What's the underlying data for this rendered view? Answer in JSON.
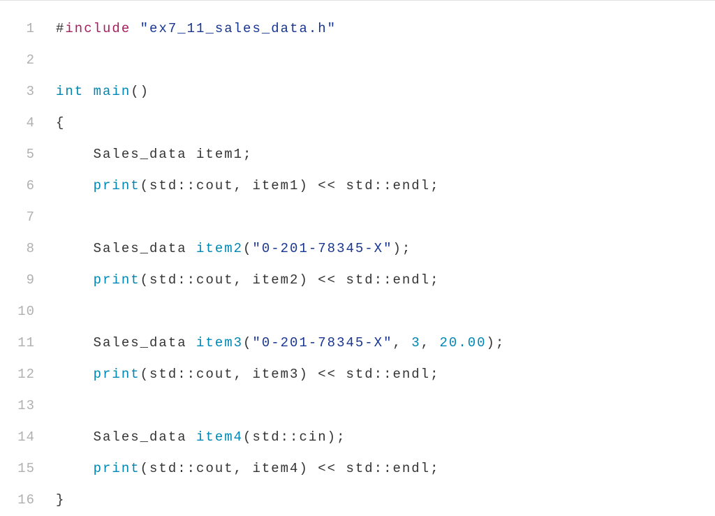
{
  "lines": [
    {
      "number": "1",
      "indent": "",
      "tokens": [
        {
          "text": "#",
          "class": "tk-text"
        },
        {
          "text": "include",
          "class": "tk-preprocessor"
        },
        {
          "text": " ",
          "class": "tk-text"
        },
        {
          "text": "\"ex7_11_sales_data.h\"",
          "class": "tk-string"
        }
      ]
    },
    {
      "number": "2",
      "indent": "",
      "tokens": []
    },
    {
      "number": "3",
      "indent": "",
      "tokens": [
        {
          "text": "int",
          "class": "tk-type"
        },
        {
          "text": " ",
          "class": "tk-text"
        },
        {
          "text": "main",
          "class": "tk-function"
        },
        {
          "text": "()",
          "class": "tk-punct"
        }
      ]
    },
    {
      "number": "4",
      "indent": "",
      "tokens": [
        {
          "text": "{",
          "class": "tk-punct"
        }
      ]
    },
    {
      "number": "5",
      "indent": "    ",
      "tokens": [
        {
          "text": "Sales_data item1;",
          "class": "tk-text"
        }
      ]
    },
    {
      "number": "6",
      "indent": "    ",
      "tokens": [
        {
          "text": "print",
          "class": "tk-function"
        },
        {
          "text": "(std::cout, item1) << std::endl;",
          "class": "tk-text"
        }
      ]
    },
    {
      "number": "7",
      "indent": "",
      "tokens": []
    },
    {
      "number": "8",
      "indent": "    ",
      "tokens": [
        {
          "text": "Sales_data ",
          "class": "tk-text"
        },
        {
          "text": "item2",
          "class": "tk-function"
        },
        {
          "text": "(",
          "class": "tk-punct"
        },
        {
          "text": "\"0-201-78345-X\"",
          "class": "tk-string"
        },
        {
          "text": ");",
          "class": "tk-punct"
        }
      ]
    },
    {
      "number": "9",
      "indent": "    ",
      "tokens": [
        {
          "text": "print",
          "class": "tk-function"
        },
        {
          "text": "(std::cout, item2) << std::endl;",
          "class": "tk-text"
        }
      ]
    },
    {
      "number": "10",
      "indent": "",
      "tokens": []
    },
    {
      "number": "11",
      "indent": "    ",
      "tokens": [
        {
          "text": "Sales_data ",
          "class": "tk-text"
        },
        {
          "text": "item3",
          "class": "tk-function"
        },
        {
          "text": "(",
          "class": "tk-punct"
        },
        {
          "text": "\"0-201-78345-X\"",
          "class": "tk-string"
        },
        {
          "text": ", ",
          "class": "tk-punct"
        },
        {
          "text": "3",
          "class": "tk-number"
        },
        {
          "text": ", ",
          "class": "tk-punct"
        },
        {
          "text": "20.00",
          "class": "tk-number"
        },
        {
          "text": ");",
          "class": "tk-punct"
        }
      ]
    },
    {
      "number": "12",
      "indent": "    ",
      "tokens": [
        {
          "text": "print",
          "class": "tk-function"
        },
        {
          "text": "(std::cout, item3) << std::endl;",
          "class": "tk-text"
        }
      ]
    },
    {
      "number": "13",
      "indent": "",
      "tokens": []
    },
    {
      "number": "14",
      "indent": "    ",
      "tokens": [
        {
          "text": "Sales_data ",
          "class": "tk-text"
        },
        {
          "text": "item4",
          "class": "tk-function"
        },
        {
          "text": "(std::cin);",
          "class": "tk-text"
        }
      ]
    },
    {
      "number": "15",
      "indent": "    ",
      "tokens": [
        {
          "text": "print",
          "class": "tk-function"
        },
        {
          "text": "(std::cout, item4) << std::endl;",
          "class": "tk-text"
        }
      ]
    },
    {
      "number": "16",
      "indent": "",
      "tokens": [
        {
          "text": "}",
          "class": "tk-punct"
        }
      ]
    }
  ]
}
